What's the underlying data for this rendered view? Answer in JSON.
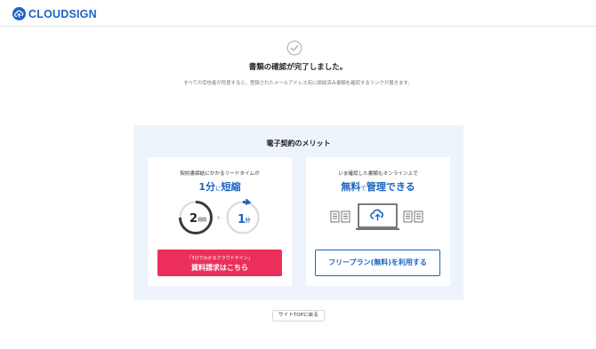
{
  "header": {
    "logo_text": "CLOUDSIGN",
    "brand_color": "#1b65c2"
  },
  "completion": {
    "icon": "check-circle-icon",
    "title": "書類の確認が完了しました。",
    "description": "すべての受信者が同意すると、登録されたメールアドレス宛に締結済み書類を確認するリンクが届きます。"
  },
  "merits": {
    "title": "電子契約のメリット",
    "left": {
      "lead": "契約書締結にかかるリードタイムが",
      "head_num": "1分",
      "head_mid": "に",
      "head_tail": "短縮",
      "before_value": "2",
      "before_unit": "週間",
      "after_value": "1",
      "after_unit": "分",
      "cta_sub": "「3分でわかるクラウドサイン」",
      "cta_main": "資料請求はこちら",
      "cta_color": "#ec2f5a"
    },
    "right": {
      "lead": "いま確認した書類もオンライン上で",
      "head_a": "無料",
      "head_mid": "で",
      "head_b": "管理できる",
      "cta_label": "フリープラン(無料)を利用する"
    }
  },
  "footer": {
    "back_label": "サイトTOPに戻る"
  }
}
